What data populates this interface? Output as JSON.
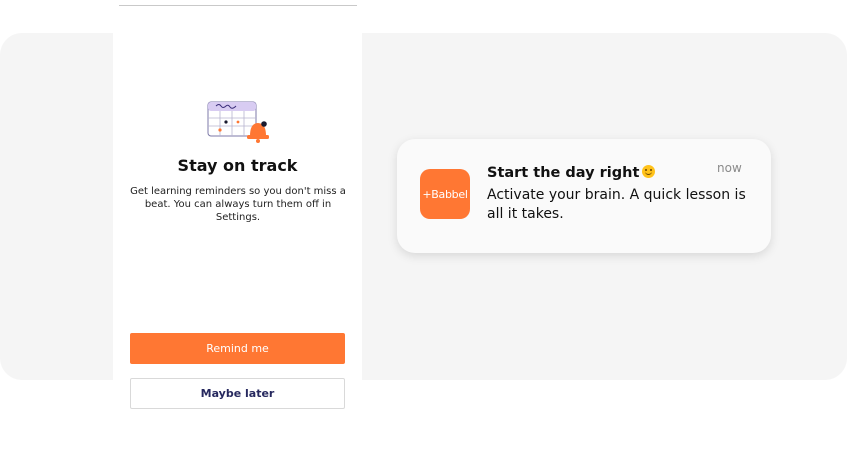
{
  "onboarding": {
    "title": "Stay on track",
    "body": "Get learning reminders so you don't miss a beat. You can always turn them off in Settings.",
    "primary_button": "Remind me",
    "secondary_button": "Maybe later"
  },
  "notification": {
    "app_icon_label": "+Babbel",
    "title": "Start the day right",
    "time": "now",
    "body": "Activate your brain. A quick lesson is all it takes."
  },
  "colors": {
    "brand": "#ff7733",
    "panel": "#f5f5f5",
    "secondary_text": "#26285e"
  },
  "icons": {
    "illustration": "calendar-bell-icon",
    "emoji": "smiley-emoji-icon"
  }
}
